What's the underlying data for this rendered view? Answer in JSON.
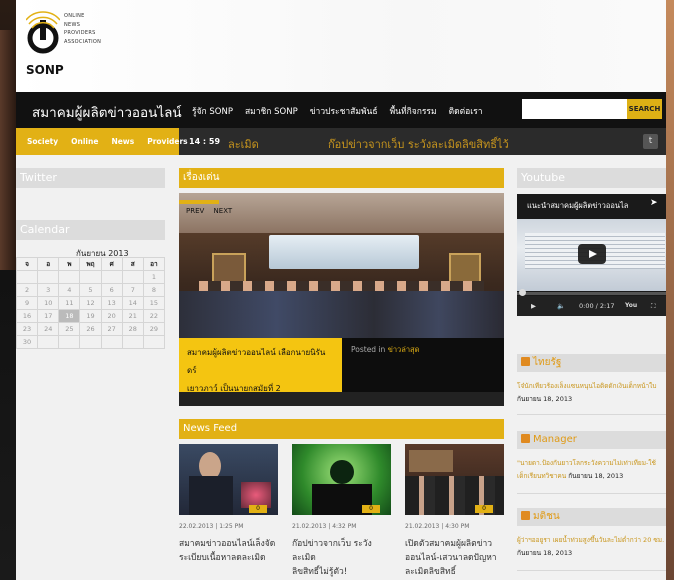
{
  "header": {
    "logo_lines": [
      "ONLINE",
      "NEWS",
      "PROVIDERS",
      "ASSOCIATION"
    ],
    "logo_short": "SONP"
  },
  "nav": {
    "site_title": "สมาคมผู้ผลิตข่าวออนไลน์",
    "links": [
      "รู้จัก SONP",
      "สมาชิก SONP",
      "ข่าวประชาสัมพันธ์",
      "พื้นที่กิจกรรม",
      "ติดต่อเรา"
    ],
    "search_label": "SEARCH"
  },
  "catbar": {
    "cats": [
      "Society",
      "Online",
      "News",
      "Providers"
    ],
    "ticker_time": "14 : 59",
    "ticker_tag": "ละเมิด",
    "ticker_text": "ก๊อปข่าวจากเว็บ ระวังละเมิดลิขสิทธิ์ไว้"
  },
  "left": {
    "twitter_title": "Twitter",
    "calendar_title": "Calendar",
    "month": "กันยายน 2013",
    "weekdays": [
      "จ",
      "อ",
      "พ",
      "พฤ",
      "ศ",
      "ส",
      "อา"
    ],
    "weeks": [
      [
        "",
        "",
        "",
        "",
        "",
        "",
        "1"
      ],
      [
        "2",
        "3",
        "4",
        "5",
        "6",
        "7",
        "8"
      ],
      [
        "9",
        "10",
        "11",
        "12",
        "13",
        "14",
        "15"
      ],
      [
        "16",
        "17",
        "18",
        "19",
        "20",
        "21",
        "22"
      ],
      [
        "23",
        "24",
        "25",
        "26",
        "27",
        "28",
        "29"
      ],
      [
        "30",
        "",
        "",
        "",
        "",
        "",
        ""
      ]
    ]
  },
  "featured": {
    "title": "เรื่องเด่น",
    "prev": "PREV",
    "next": "NEXT",
    "caption_line1": "สมาคมผู้ผลิตข่าวออนไลน์ เลือกนายนิรันดร์",
    "caption_line2": "เยาวภาว์ เป็นนายกสมัยที่ 2",
    "posted_in": "Posted in",
    "category": "ข่าวล่าสุด"
  },
  "newsfeed": {
    "title": "News Feed",
    "items": [
      {
        "date": "22.02.2013 | 1:25 PM",
        "title_line1": "สมาคมข่าวออนไลน์เล็งจัด",
        "title_line2": "ระเบียบเนื้อหาลดละเมิด",
        "count": "0"
      },
      {
        "date": "21.02.2013 | 4:32 PM",
        "title_line1": "ก๊อปข่าวจากเว็บ ระวังละเมิด",
        "title_line2": "ลิขสิทธิ์ไม่รู้ตัว!",
        "count": "0"
      },
      {
        "date": "21.02.2013 | 4:30 PM",
        "title_line1": "เปิดตัวสมาคมผู้ผลิตข่าว",
        "title_line2": "ออนไลน์-เสวนาลดปัญหา",
        "title_line3": "ละเมิดลิขสิทธิ์",
        "count": "0"
      }
    ]
  },
  "right": {
    "youtube_title": "Youtube",
    "video_title": "แนะนำสมาคมผู้ผลิตข่าวออนไล",
    "video_time": "0:00 / 2:17",
    "feeds": [
      {
        "name": "ไทยรัฐ",
        "text": "โจ๋นักเทียวร้องเล็งแซนหนุนไอติดดักเงินเด็กหน้าใบ",
        "date": "กันยายน 18, 2013"
      },
      {
        "name": "Manager",
        "text": "\"นายดา.ป้องกันยาวโลกระวังความไม่เท่าเทียม-ใช้เด็กเรียนทวิชาคน",
        "date": "กันยายน 18, 2013"
      },
      {
        "name": "มติชน",
        "text": "ผู้ว่าฯออยูรา เผยน้ำท่วมสูงขึ้นวันละไม่ต่ำกว่า 20 ซม.",
        "date": "กันยายน 18, 2013"
      }
    ]
  },
  "colors": {
    "accent": "#e2b115",
    "nav": "#111111",
    "ticker": "#c9961d"
  }
}
